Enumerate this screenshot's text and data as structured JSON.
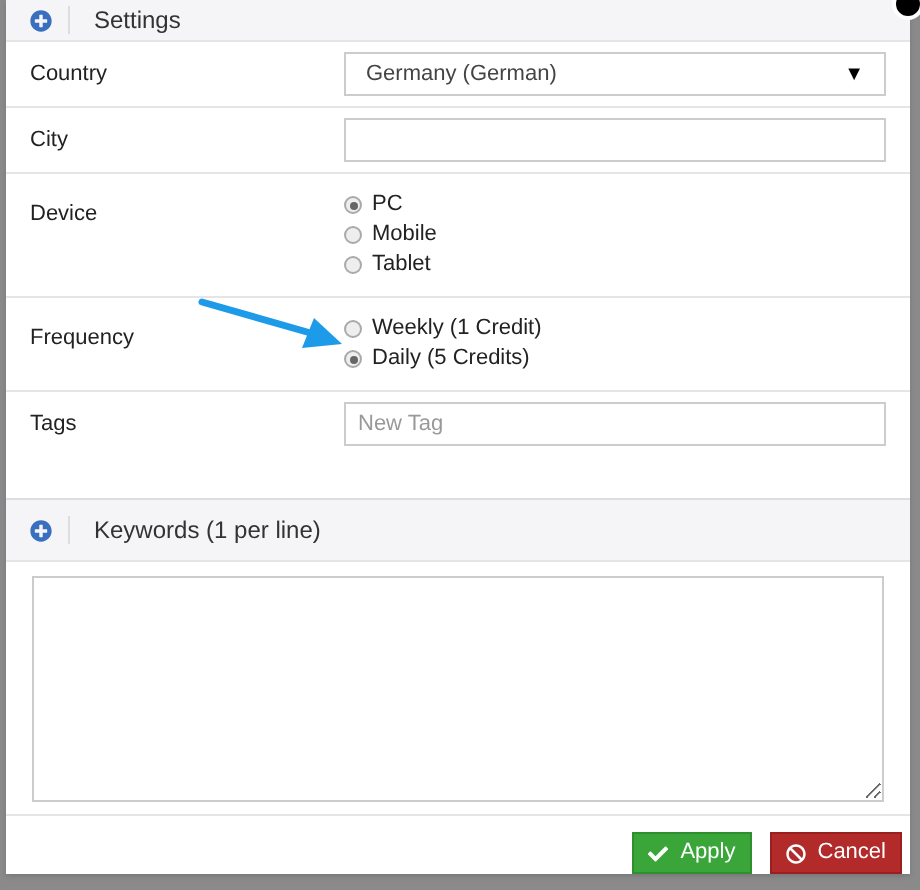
{
  "settings": {
    "title": "Settings"
  },
  "fields": [
    {
      "kind": "select",
      "label": "Country",
      "value": "Germany (German)",
      "caret": "▼"
    },
    {
      "kind": "text",
      "label": "City"
    },
    {
      "kind": "radio",
      "label": "Device",
      "options": [
        {
          "label": "PC",
          "selected": true
        },
        {
          "label": "Mobile",
          "selected": false
        },
        {
          "label": "Tablet",
          "selected": false
        }
      ]
    },
    {
      "kind": "radio",
      "label": "Frequency",
      "arrow": true,
      "options": [
        {
          "label": "Weekly (1 Credit)",
          "selected": false
        },
        {
          "label": "Daily (5 Credits)",
          "selected": true
        }
      ]
    },
    {
      "kind": "text",
      "label": "Tags",
      "placeholder": "New Tag"
    }
  ],
  "keywords": {
    "title": "Keywords (1 per line)"
  },
  "buttons": [
    {
      "kind": "apply",
      "label": "Apply"
    },
    {
      "kind": "cancel",
      "label": "Cancel"
    }
  ]
}
